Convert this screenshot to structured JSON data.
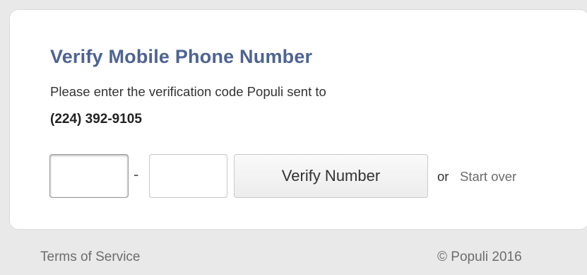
{
  "card": {
    "title": "Verify Mobile Phone Number",
    "instruction": "Please enter the verification code Populi sent to",
    "phone_number": "(224) 392-9105"
  },
  "form": {
    "code_part1_value": "",
    "code_part2_value": "",
    "separator": "-",
    "verify_button_label": "Verify Number",
    "or_text": "or",
    "start_over_label": "Start over"
  },
  "footer": {
    "terms_label": "Terms of Service",
    "copyright": "© Populi 2016"
  },
  "colors": {
    "title": "#4e6392",
    "background": "#e9e9e9",
    "card": "#ffffff"
  }
}
